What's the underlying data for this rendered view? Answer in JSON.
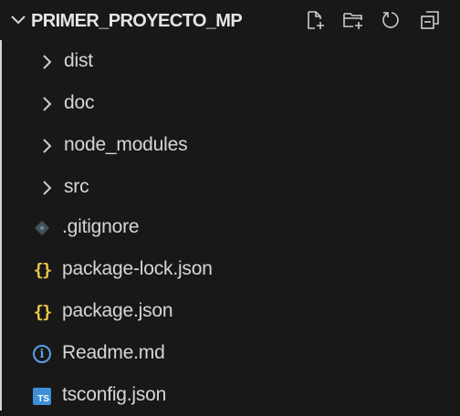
{
  "explorer": {
    "project_title": "PRIMER_PROYECTO_MP",
    "actions": [
      {
        "name": "new-file-icon"
      },
      {
        "name": "new-folder-icon"
      },
      {
        "name": "refresh-icon"
      },
      {
        "name": "collapse-all-icon"
      }
    ],
    "folders": [
      {
        "label": "dist"
      },
      {
        "label": "doc"
      },
      {
        "label": "node_modules"
      },
      {
        "label": "src"
      }
    ],
    "files": [
      {
        "label": ".gitignore",
        "icon": "git-icon"
      },
      {
        "label": "package-lock.json",
        "icon": "json-icon"
      },
      {
        "label": "package.json",
        "icon": "json-icon"
      },
      {
        "label": "Readme.md",
        "icon": "info-icon"
      },
      {
        "label": "tsconfig.json",
        "icon": "typescript-icon",
        "badge": "TS"
      }
    ]
  },
  "colors": {
    "background": "#181818",
    "text": "#d6d6d6",
    "json_icon": "#e7c547",
    "info_icon": "#5aa0e8",
    "ts_badge": "#3d8fd6"
  }
}
